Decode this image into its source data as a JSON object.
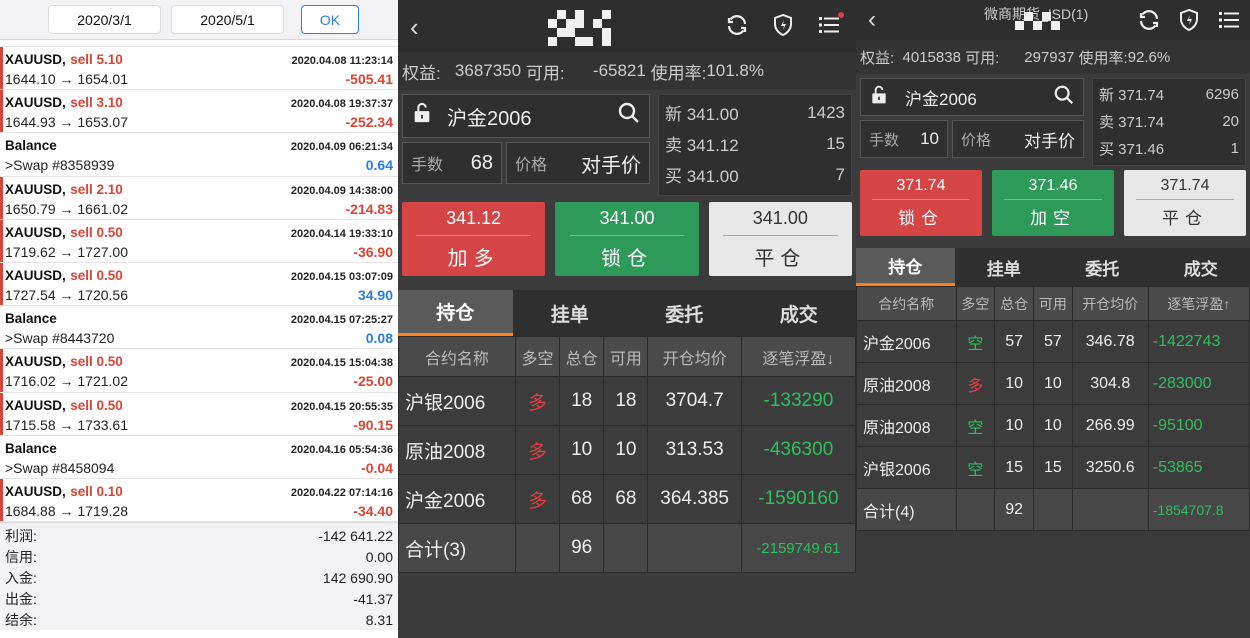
{
  "panel1": {
    "start_date": "2020/3/1",
    "end_date": "2020/5/1",
    "ok_label": "OK",
    "trades": [
      {
        "kind": "trade",
        "symbol": "XAUUSD,",
        "side": "sell 5.10",
        "time": "2020.04.08 11:23:14",
        "prices": "1644.10 → 1654.01",
        "pl": "-505.41",
        "sign": "neg"
      },
      {
        "kind": "trade",
        "symbol": "XAUUSD,",
        "side": "sell 3.10",
        "time": "2020.04.08 19:37:37",
        "prices": "1644.93 → 1653.07",
        "pl": "-252.34",
        "sign": "neg"
      },
      {
        "kind": "balance",
        "symbol": "Balance",
        "side": "",
        "time": "2020.04.09 06:21:34",
        "prices": ">Swap #8358939",
        "pl": "0.64",
        "sign": "pos"
      },
      {
        "kind": "trade",
        "symbol": "XAUUSD,",
        "side": "sell 2.10",
        "time": "2020.04.09 14:38:00",
        "prices": "1650.79 → 1661.02",
        "pl": "-214.83",
        "sign": "neg"
      },
      {
        "kind": "trade",
        "symbol": "XAUUSD,",
        "side": "sell 0.50",
        "time": "2020.04.14 19:33:10",
        "prices": "1719.62 → 1727.00",
        "pl": "-36.90",
        "sign": "neg"
      },
      {
        "kind": "trade",
        "symbol": "XAUUSD,",
        "side": "sell 0.50",
        "time": "2020.04.15 03:07:09",
        "prices": "1727.54 → 1720.56",
        "pl": "34.90",
        "sign": "pos"
      },
      {
        "kind": "balance",
        "symbol": "Balance",
        "side": "",
        "time": "2020.04.15 07:25:27",
        "prices": ">Swap #8443720",
        "pl": "0.08",
        "sign": "pos"
      },
      {
        "kind": "trade",
        "symbol": "XAUUSD,",
        "side": "sell 0.50",
        "time": "2020.04.15 15:04:38",
        "prices": "1716.02 → 1721.02",
        "pl": "-25.00",
        "sign": "neg"
      },
      {
        "kind": "trade",
        "symbol": "XAUUSD,",
        "side": "sell 0.50",
        "time": "2020.04.15 20:55:35",
        "prices": "1715.58 → 1733.61",
        "pl": "-90.15",
        "sign": "neg"
      },
      {
        "kind": "balance",
        "symbol": "Balance",
        "side": "",
        "time": "2020.04.16 05:54:36",
        "prices": ">Swap #8458094",
        "pl": "-0.04",
        "sign": "neg"
      },
      {
        "kind": "trade",
        "symbol": "XAUUSD,",
        "side": "sell 0.10",
        "time": "2020.04.22 07:14:16",
        "prices": "1684.88 → 1719.28",
        "pl": "-34.40",
        "sign": "neg"
      }
    ],
    "summary": [
      {
        "label": "利润:",
        "value": "-142 641.22"
      },
      {
        "label": "信用:",
        "value": "0.00"
      },
      {
        "label": "入金:",
        "value": "142 690.90"
      },
      {
        "label": "出金:",
        "value": "-41.37"
      },
      {
        "label": "结余:",
        "value": "8.31"
      }
    ]
  },
  "panel2": {
    "equity_label": "权益:",
    "equity": "3687350",
    "available_label": "可用:",
    "available": "-65821",
    "usage_label": "使用率:",
    "usage": "101.8%",
    "contract": "沪金2006",
    "qty_label": "手数",
    "qty": "68",
    "price_label": "价格",
    "price_mode": "对手价",
    "quotes": [
      {
        "label": "新 341.00",
        "vol": "1423"
      },
      {
        "label": "卖 341.12",
        "vol": "15"
      },
      {
        "label": "买 341.00",
        "vol": "7"
      }
    ],
    "buttons": [
      {
        "price": "341.12",
        "label": "加多"
      },
      {
        "price": "341.00",
        "label": "锁仓"
      },
      {
        "price": "341.00",
        "label": "平仓"
      }
    ],
    "tabs": [
      "持仓",
      "挂单",
      "委托",
      "成交"
    ],
    "columns": [
      "合约名称",
      "多空",
      "总仓",
      "可用",
      "开仓均价",
      "逐笔浮盈↓"
    ],
    "rows": [
      {
        "name": "沪银2006",
        "dir": "多",
        "total": "18",
        "avail": "18",
        "avg": "3704.7",
        "pl": "-133290"
      },
      {
        "name": "原油2008",
        "dir": "多",
        "total": "10",
        "avail": "10",
        "avg": "313.53",
        "pl": "-436300"
      },
      {
        "name": "沪金2006",
        "dir": "多",
        "total": "68",
        "avail": "68",
        "avg": "364.385",
        "pl": "-1590160"
      }
    ],
    "total": {
      "name": "合计(3)",
      "total": "96",
      "pl": "-2159749.61"
    }
  },
  "panel3": {
    "title_partial": "微商期货_ISD(1)",
    "equity_label": "权益:",
    "equity": "4015838",
    "available_label": "可用:",
    "available": "297937",
    "usage_label": "使用率:",
    "usage": "92.6%",
    "contract": "沪金2006",
    "qty_label": "手数",
    "qty": "10",
    "price_label": "价格",
    "price_mode": "对手价",
    "quotes": [
      {
        "label": "新 371.74",
        "vol": "6296"
      },
      {
        "label": "卖 371.74",
        "vol": "20"
      },
      {
        "label": "买 371.46",
        "vol": "1"
      }
    ],
    "buttons": [
      {
        "price": "371.74",
        "label": "锁仓"
      },
      {
        "price": "371.46",
        "label": "加空"
      },
      {
        "price": "371.74",
        "label": "平仓"
      }
    ],
    "tabs": [
      "持仓",
      "挂单",
      "委托",
      "成交"
    ],
    "columns": [
      "合约名称",
      "多空",
      "总仓",
      "可用",
      "开仓均价",
      "逐笔浮盈↑"
    ],
    "rows": [
      {
        "name": "沪金2006",
        "dir": "空",
        "total": "57",
        "avail": "57",
        "avg": "346.78",
        "pl": "-1422743"
      },
      {
        "name": "原油2008",
        "dir": "多",
        "total": "10",
        "avail": "10",
        "avg": "304.8",
        "pl": "-283000"
      },
      {
        "name": "原油2008",
        "dir": "空",
        "total": "10",
        "avail": "10",
        "avg": "266.99",
        "pl": "-95100"
      },
      {
        "name": "沪银2006",
        "dir": "空",
        "total": "15",
        "avail": "15",
        "avg": "3250.6",
        "pl": "-53865"
      }
    ],
    "total": {
      "name": "合计(4)",
      "total": "92",
      "pl": "-1854707.8"
    }
  },
  "colors": {
    "long": "#e04040",
    "short": "#2fbf5f",
    "accent_tab": "#ff7f1a",
    "sell": "#d94436",
    "profit_pos": "#2a7de1"
  }
}
